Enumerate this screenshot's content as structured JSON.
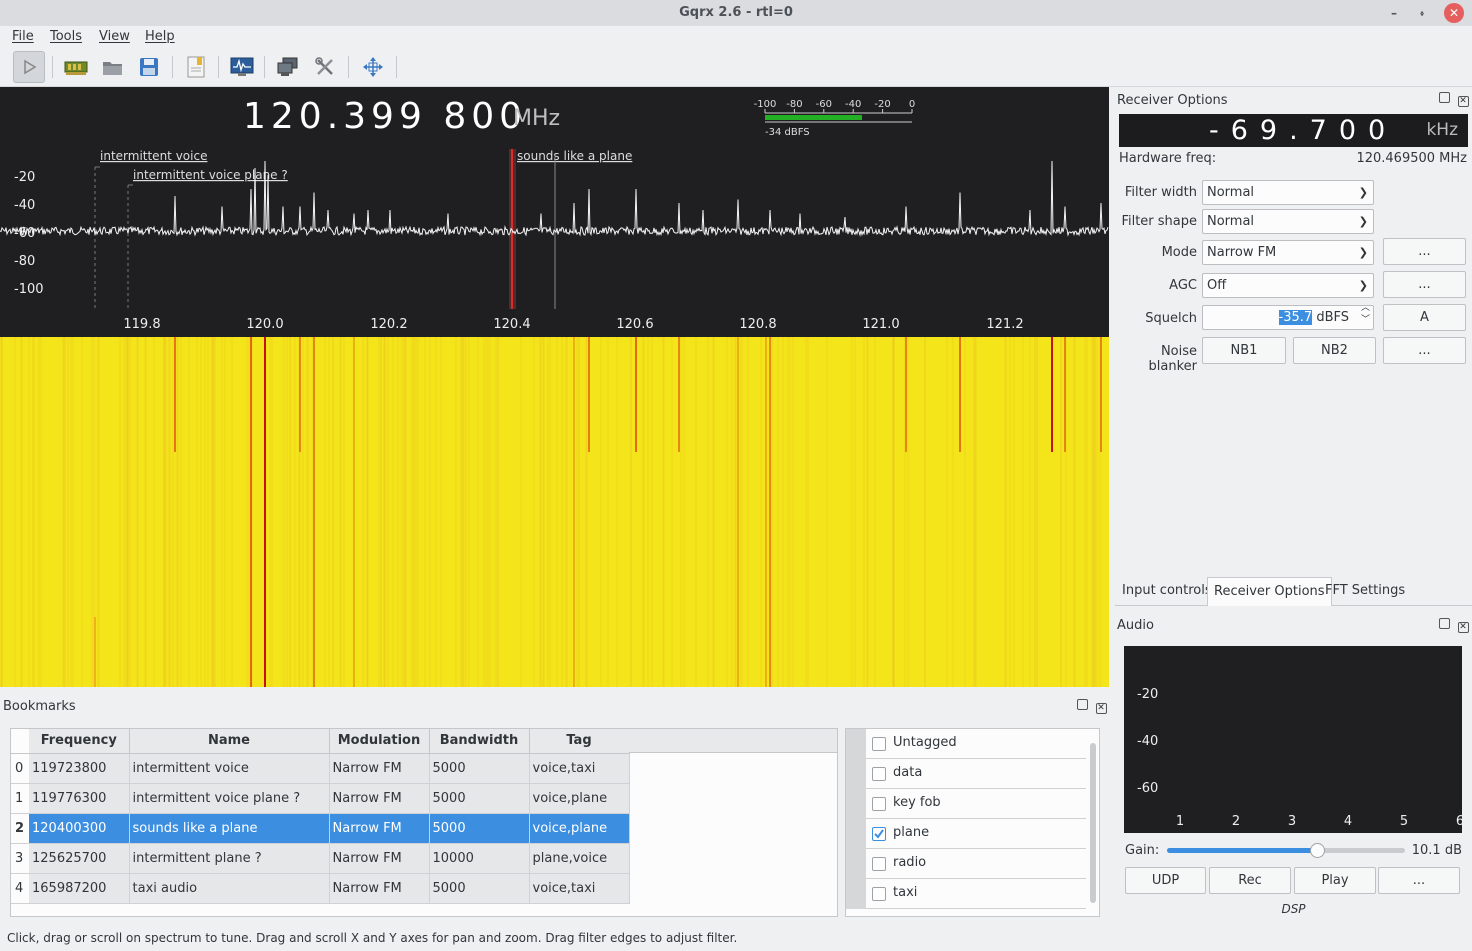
{
  "window": {
    "title": "Gqrx 2.6 - rtl=0",
    "min_glyph": "–",
    "max_glyph": "⬫",
    "close_glyph": "✕"
  },
  "menu": [
    "File",
    "Tools",
    "View",
    "Help"
  ],
  "plot": {
    "frequency": "120.399 800",
    "unit": "MHz",
    "meter_scale": [
      "-100",
      "-80",
      "-60",
      "-40",
      "-20",
      "0"
    ],
    "meter_level_text": "-34 dBFS",
    "meter_level_dbfs": -34,
    "y_ticks": [
      "-20",
      "-40",
      "-60",
      "-80",
      "-100"
    ],
    "x_ticks": [
      "119.8",
      "120.0",
      "120.2",
      "120.4",
      "120.6",
      "120.8",
      "121.0",
      "121.2"
    ],
    "bookmark_labels": [
      "intermittent voice",
      "intermittent voice  plane ?",
      "sounds like a plane"
    ]
  },
  "receiver_options": {
    "title": "Receiver Options",
    "offset_value": "-69.700",
    "offset_unit": "kHz",
    "hw_freq_label": "Hardware freq:",
    "hw_freq_value": "120.469500 MHz",
    "filter_width_label": "Filter width",
    "filter_width_value": "Normal",
    "filter_shape_label": "Filter shape",
    "filter_shape_value": "Normal",
    "mode_label": "Mode",
    "mode_value": "Narrow FM",
    "agc_label": "AGC",
    "agc_value": "Off",
    "squelch_label": "Squelch",
    "squelch_value": "-35.7",
    "squelch_unit": " dBFS",
    "squelch_btn": "A",
    "nb_label": "Noise blanker",
    "nb1": "NB1",
    "nb2": "NB2",
    "more": "..."
  },
  "tabs": [
    "Input controls",
    "Receiver Options",
    "FFT Settings"
  ],
  "audio": {
    "title": "Audio",
    "y_ticks": [
      "-20",
      "-40",
      "-60"
    ],
    "x_ticks": [
      "1",
      "2",
      "3",
      "4",
      "5",
      "6"
    ],
    "gain_label": "Gain:",
    "gain_value": "10.1 dB",
    "gain_fraction": 0.63,
    "buttons": [
      "UDP",
      "Rec",
      "Play",
      "..."
    ],
    "dsp_label": "DSP"
  },
  "bookmarks": {
    "title": "Bookmarks",
    "columns": [
      "Frequency",
      "Name",
      "Modulation",
      "Bandwidth",
      "Tag"
    ],
    "rows": [
      {
        "n": "0",
        "freq": "119723800",
        "name": "intermittent voice",
        "mod": "Narrow FM",
        "bw": "5000",
        "tag": "voice,taxi"
      },
      {
        "n": "1",
        "freq": "119776300",
        "name": "intermittent voice  plane ?",
        "mod": "Narrow FM",
        "bw": "5000",
        "tag": "voice,plane"
      },
      {
        "n": "2",
        "freq": "120400300",
        "name": "sounds like a plane",
        "mod": "Narrow FM",
        "bw": "5000",
        "tag": "voice,plane"
      },
      {
        "n": "3",
        "freq": "125625700",
        "name": "intermittent plane ?",
        "mod": "Narrow FM",
        "bw": "10000",
        "tag": "plane,voice"
      },
      {
        "n": "4",
        "freq": "165987200",
        "name": "taxi audio",
        "mod": "Narrow FM",
        "bw": "5000",
        "tag": "voice,taxi"
      }
    ],
    "tags": [
      {
        "label": "Untagged",
        "checked": false
      },
      {
        "label": "data",
        "checked": false
      },
      {
        "label": "key fob",
        "checked": false
      },
      {
        "label": "plane",
        "checked": true
      },
      {
        "label": "radio",
        "checked": false
      },
      {
        "label": "taxi",
        "checked": false
      }
    ]
  },
  "status_text": "Click, drag or scroll on spectrum to tune. Drag and scroll X and Y axes for pan and zoom. Drag filter edges to adjust filter."
}
